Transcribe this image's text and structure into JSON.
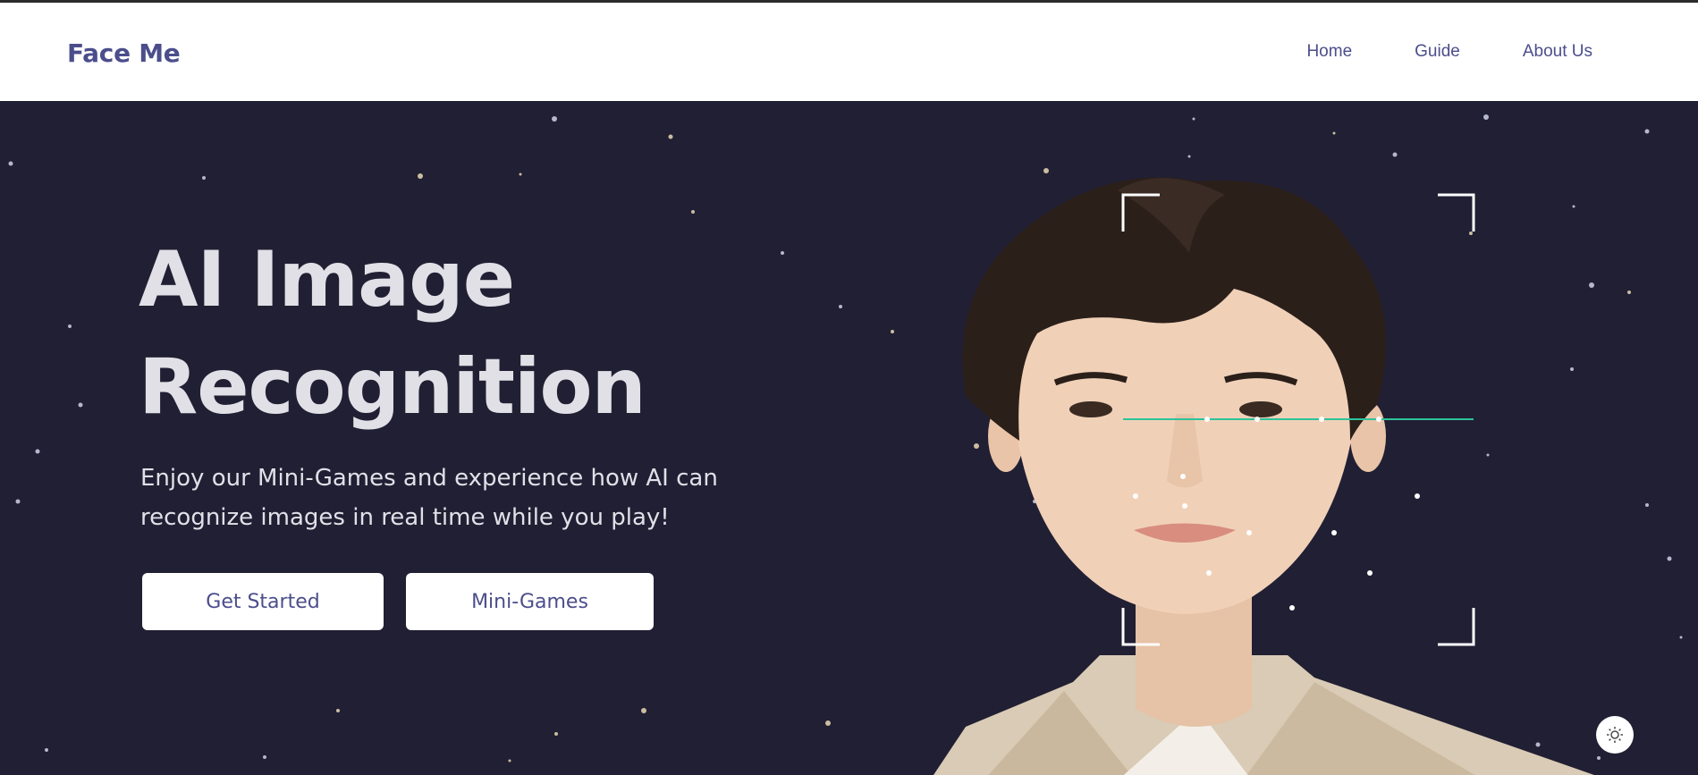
{
  "header": {
    "logo": "Face Me",
    "nav": [
      {
        "label": "Home"
      },
      {
        "label": "Guide"
      },
      {
        "label": "About Us"
      }
    ]
  },
  "hero": {
    "title_line1": "AI Image",
    "title_line2": "Recognition",
    "subtitle": "Enjoy our Mini-Games and experience how AI can recognize images in real time while you play!",
    "buttons": {
      "get_started": "Get Started",
      "mini_games": "Mini-Games"
    },
    "image": "face-recognition-portrait",
    "theme_toggle_icon": "sun-icon"
  },
  "colors": {
    "brand": "#4b4e8b",
    "hero_bg": "#211f33",
    "scan_line": "#2ec39a",
    "button_bg": "#ffffff"
  }
}
